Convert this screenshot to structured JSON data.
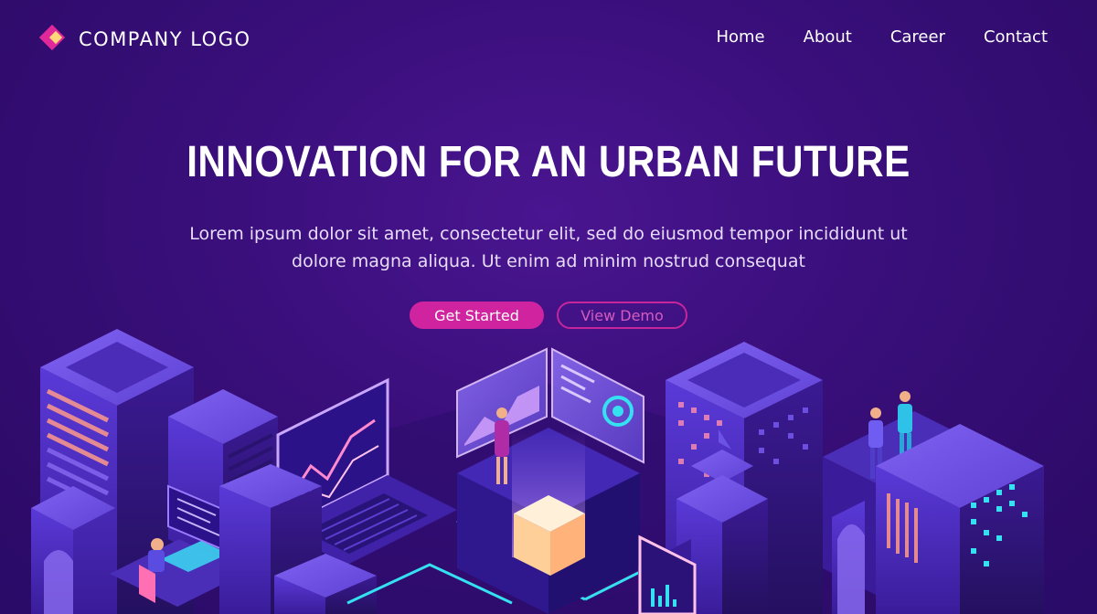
{
  "header": {
    "logo_text": "COMPANY LOGO"
  },
  "nav": {
    "items": [
      "Home",
      "About",
      "Career",
      "Contact"
    ]
  },
  "hero": {
    "title": "INNOVATION FOR AN URBAN FUTURE",
    "subtitle_line1": "Lorem ipsum dolor sit amet, consectetur elit, sed do eiusmod tempor incididunt ut",
    "subtitle_line2": "dolore magna aliqua. Ut enim ad minim nostrud consequat",
    "primary_button": "Get Started",
    "secondary_button": "View Demo"
  },
  "colors": {
    "background": "#3a0f7c",
    "accent": "#d0239f",
    "logo_secondary": "#ffd77a",
    "cube": "#ffd8a6",
    "neon": "#35e0f0"
  }
}
